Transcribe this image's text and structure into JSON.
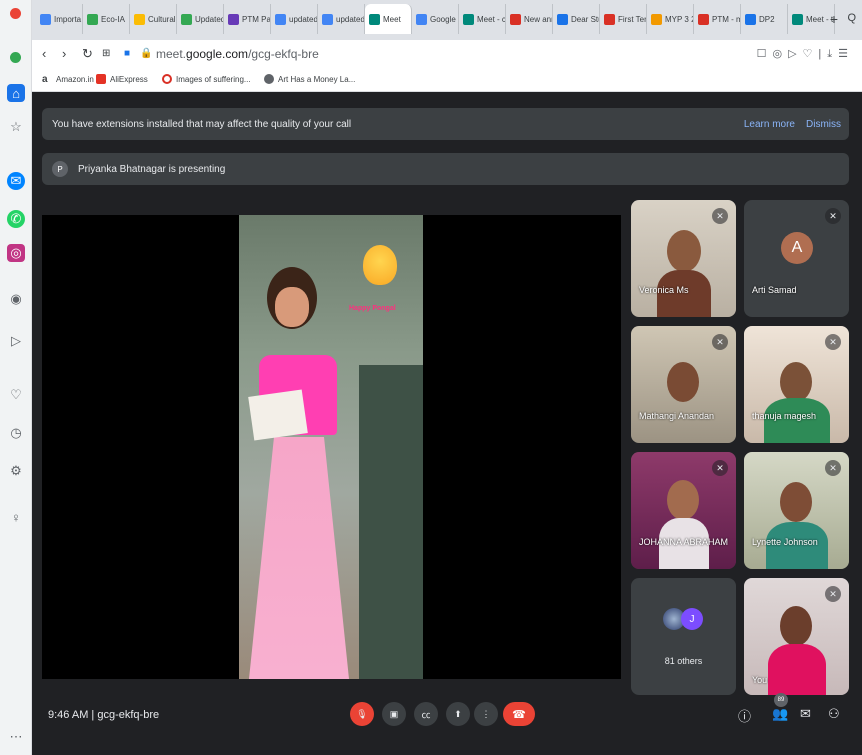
{
  "browser": {
    "tabs": [
      {
        "label": "Importa",
        "color": "#4285f4"
      },
      {
        "label": "Eco-IA",
        "color": "#34a853"
      },
      {
        "label": "Cultural",
        "color": "#fbbc04"
      },
      {
        "label": "Updated",
        "color": "#34a853"
      },
      {
        "label": "PTM Pa",
        "color": "#673ab7"
      },
      {
        "label": "updated",
        "color": "#4285f4"
      },
      {
        "label": "updated",
        "color": "#4285f4"
      },
      {
        "label": "Meet",
        "color": "#00897b",
        "active": true
      },
      {
        "label": "Google",
        "color": "#4285f4"
      },
      {
        "label": "Meet - c",
        "color": "#00897b"
      },
      {
        "label": "New ann",
        "color": "#d93025"
      },
      {
        "label": "Dear Stu",
        "color": "#1a73e8"
      },
      {
        "label": "First Ter",
        "color": "#d93025"
      },
      {
        "label": "MYP 3 2",
        "color": "#f29900"
      },
      {
        "label": "PTM - m",
        "color": "#d93025"
      },
      {
        "label": "DP2",
        "color": "#1a73e8"
      },
      {
        "label": "Meet - t",
        "color": "#00897b"
      }
    ],
    "new_tab": "+",
    "search_tabs": "Q",
    "url_prefix": "meet.",
    "url_domain": "google.com",
    "url_path": "/gcg-ekfq-bre",
    "bookmarks": [
      {
        "label": "Amazon.in",
        "color": "#000000"
      },
      {
        "label": "AliExpress",
        "color": "#e43225"
      },
      {
        "label": "Images of suffering...",
        "color": "#d93025"
      },
      {
        "label": "Art Has a Money La...",
        "color": "#5f6368"
      }
    ]
  },
  "meet": {
    "extension_banner": "You have extensions installed that may affect the quality of your call",
    "learn_more": "Learn more",
    "dismiss": "Dismiss",
    "presenter_initial": "P",
    "presenting_text": "Priyanka Bhatnagar is presenting",
    "slide_text": "Happy Pongal",
    "participants": [
      {
        "name": "Veronica Ms"
      },
      {
        "name": "Arti Samad",
        "initial": "A"
      },
      {
        "name": "Mathangi Anandan"
      },
      {
        "name": "thanuja magesh"
      },
      {
        "name": "JOHANNA ABRAHAM"
      },
      {
        "name": "Lynette Johnson"
      },
      {
        "name": "You"
      }
    ],
    "others": {
      "initial": "J",
      "label": "81 others"
    },
    "time": "9:46 AM",
    "separator": "|",
    "meeting_code": "gcg-ekfq-bre",
    "participant_count": "89"
  }
}
